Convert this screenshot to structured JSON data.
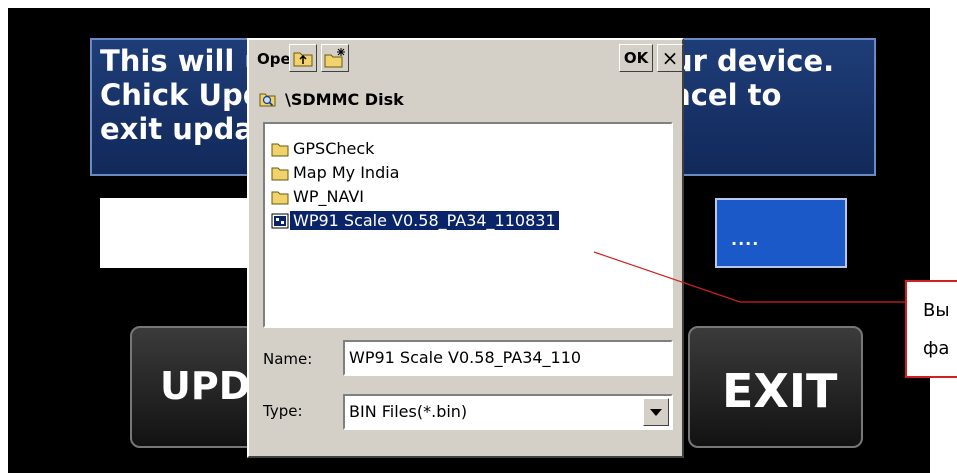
{
  "screen": {
    "message": "This will update the firmware of your device.\nChick Update to start update or Cancel to\nexit update.",
    "progress_text": "....",
    "update_button": "UPDATE",
    "exit_button": "EXIT"
  },
  "dialog": {
    "title": "Open",
    "up_icon": "folder-up-icon",
    "new_folder_icon": "new-folder-icon",
    "ok_label": "OK",
    "close_label": "×",
    "path": "\\SDMMC Disk",
    "files": [
      {
        "name": "GPSCheck",
        "icon": "folder-icon"
      },
      {
        "name": "Map My India",
        "icon": "folder-icon"
      },
      {
        "name": "WP_NAVI",
        "icon": "folder-icon"
      },
      {
        "name": "WP91 Scale V0.58_PA34_110831",
        "icon": "bin-file-icon",
        "selected": true
      }
    ],
    "name_label": "Name:",
    "name_value": "WP91 Scale V0.58_PA34_110",
    "type_label": "Type:",
    "type_value": "BIN Files(*.bin)"
  },
  "annotation": {
    "text": "Вы\nфа",
    "color": "#d02020"
  },
  "colors": {
    "selection": "#0a246a",
    "panel": "#1e3d78",
    "dialog_bg": "#d4d0c8"
  }
}
